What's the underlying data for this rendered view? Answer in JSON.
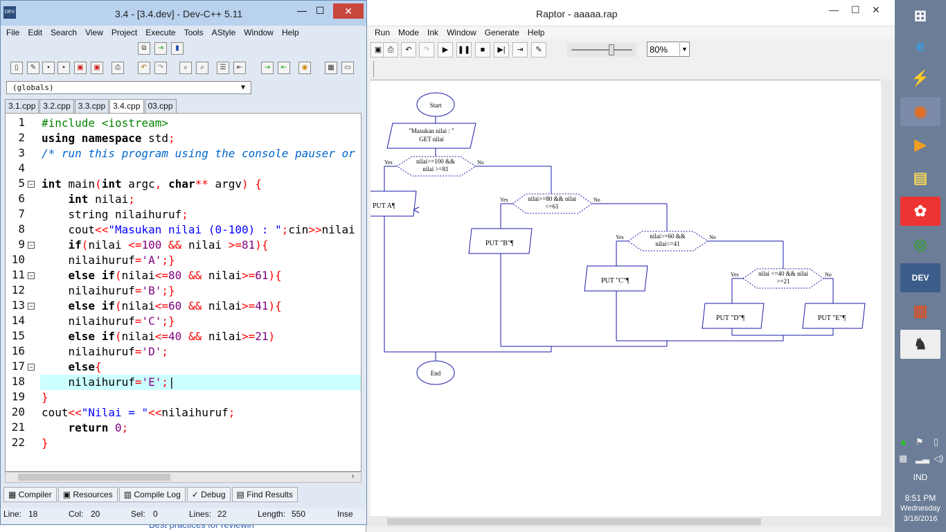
{
  "devcpp": {
    "title": "3.4 - [3.4.dev] - Dev-C++ 5.11",
    "menu": [
      "File",
      "Edit",
      "Search",
      "View",
      "Project",
      "Execute",
      "Tools",
      "AStyle",
      "Window",
      "Help"
    ],
    "scope_combo": "(globals)",
    "tabs": [
      "3.1.cpp",
      "3.2.cpp",
      "3.3.cpp",
      "3.4.cpp",
      "03.cpp"
    ],
    "active_tab": "3.4.cpp",
    "line_numbers": [
      "1",
      "2",
      "3",
      "4",
      "5",
      "6",
      "7",
      "8",
      "9",
      "10",
      "11",
      "12",
      "13",
      "14",
      "15",
      "16",
      "17",
      "18",
      "19",
      "20",
      "21",
      "22"
    ],
    "bottom_tabs": [
      "Compiler",
      "Resources",
      "Compile Log",
      "Debug",
      "Find Results"
    ],
    "status": {
      "line_label": "Line:",
      "line": "18",
      "col_label": "Col:",
      "col": "20",
      "sel_label": "Sel:",
      "sel": "0",
      "lines_label": "Lines:",
      "lines": "22",
      "length_label": "Length:",
      "length": "550",
      "mode": "Inse"
    },
    "behind_text": "Best practices for reviewin"
  },
  "raptor": {
    "title": "Raptor - aaaaa.rap",
    "menu": [
      "Run",
      "Mode",
      "Ink",
      "Window",
      "Generate",
      "Help"
    ],
    "zoom": "80%",
    "flow": {
      "start": "Start",
      "input_prompt": "\"Masukan nilai : \"",
      "input_get": "GET nilai",
      "d1a": "nilai>=100 &&",
      "d1b": "nilai >=81",
      "d2a": "nilai>=80 && nilai",
      "d2b": "<=61",
      "d3a": "nilai>=60 &&",
      "d3b": "nilai<=41",
      "d4a": "nilai <=40 && nilai",
      "d4b": ">=21",
      "yes": "Yes",
      "no": "No",
      "putA": "PUT A¶",
      "putB": "PUT \"B\"¶",
      "putC": "PUT \"C\"¶",
      "putD": "PUT \"D\"¶",
      "putE": "PUT \"E\"¶",
      "end": "End"
    }
  },
  "taskbar": {
    "lang": "IND",
    "time": "8:51 PM",
    "day": "Wednesday",
    "date": "3/16/2016"
  }
}
